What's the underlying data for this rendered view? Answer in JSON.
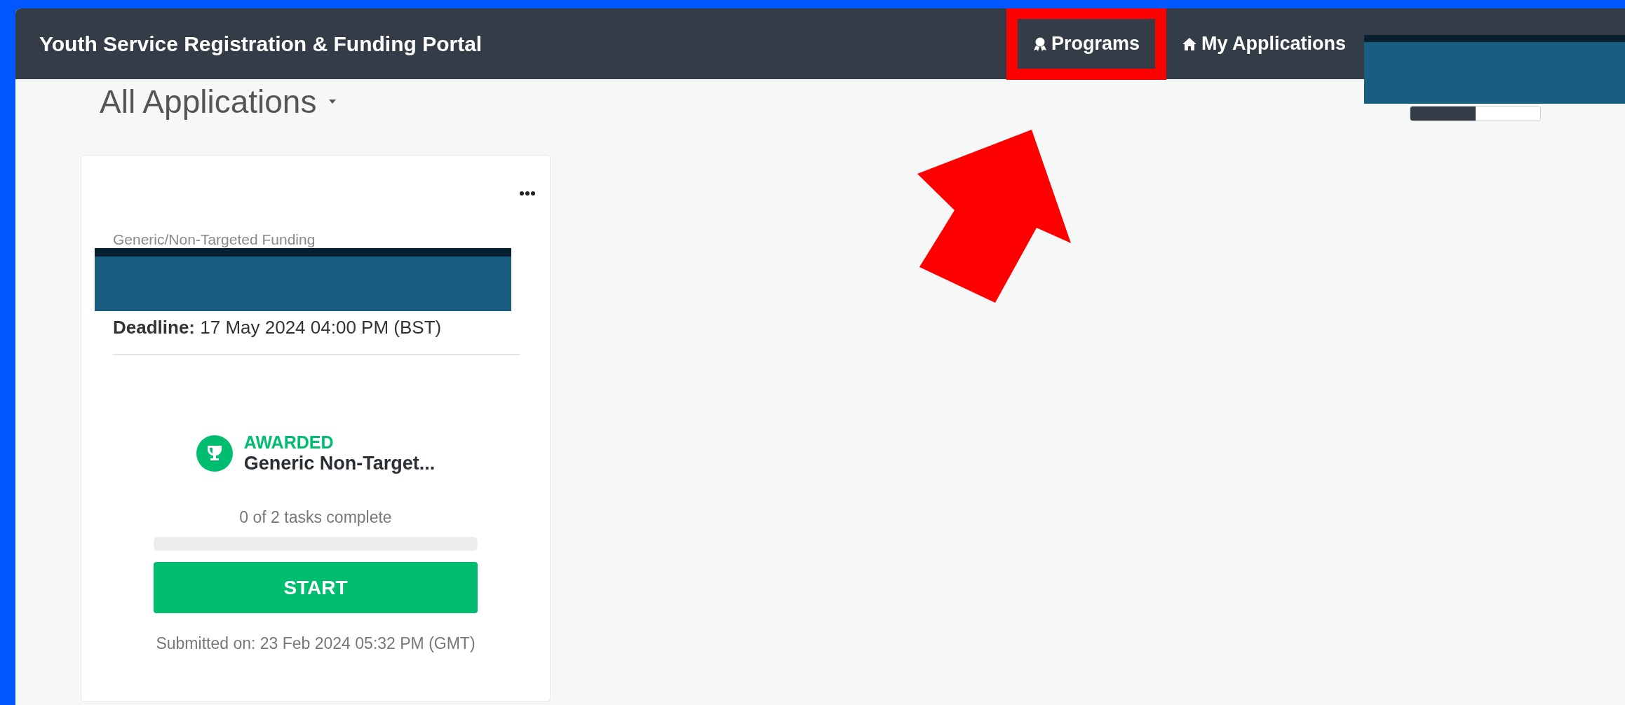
{
  "header": {
    "title": "Youth Service Registration & Funding Portal",
    "nav_items": [
      {
        "label": "Programs",
        "highlighted": true
      },
      {
        "label": "My Applications",
        "highlighted": false
      }
    ]
  },
  "page": {
    "title": "All Applications"
  },
  "applications": [
    {
      "category": "Generic/Non-Targeted Funding",
      "deadline_label": "Deadline:",
      "deadline": "17 May 2024 04:00 PM (BST)",
      "status": "AWARDED",
      "program": "Generic Non-Target...",
      "tasks": "0 of 2 tasks complete",
      "level": 0,
      "button": "START",
      "submitted": "Submitted on: 23 Feb 2024 05:32 PM (GMT)"
    }
  ]
}
